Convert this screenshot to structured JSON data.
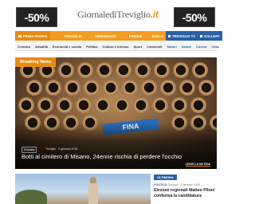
{
  "header": {
    "ad_left": "-50%",
    "ad_right": "-50%",
    "logo_main": "GiornalediTreviglio",
    "logo_suffix": ".it"
  },
  "nav": {
    "items": [
      "Prima pagina",
      "Treviglio",
      "Gerenzano",
      "Frenze",
      "Bolla"
    ],
    "tv_label": "Treviglio TV",
    "gallery_label": "Gallery"
  },
  "subnav": {
    "items": [
      "Cronaca",
      "Attualità",
      "Economia e scuola",
      "Politica",
      "Cultura e turismo",
      "Sport",
      "Commenti"
    ],
    "right_items": [
      "Motori",
      "Salute",
      "Cucina",
      "Casa"
    ]
  },
  "hero": {
    "breaking_label": "Breaking News",
    "tag": "Cronaca",
    "date": "Treviglio · 2 gennaio 2018",
    "title": "Botti al cimitero di Misano, 24enne rischia di perdere l'occhio",
    "readmore": "LEGGI LA NOTIZIA",
    "stripe_text": "FINA"
  },
  "side_article": {
    "badge": "ULTIMORA",
    "category": "POLITICA",
    "meta_rest": "Gennaio · 2 gennaio 2018",
    "headline": "Elezioni regionali Matteo Piloni conferma la candidatura"
  },
  "colors": {
    "accent_orange": "#f39c1f",
    "brand_blue": "#2b5fa6"
  }
}
